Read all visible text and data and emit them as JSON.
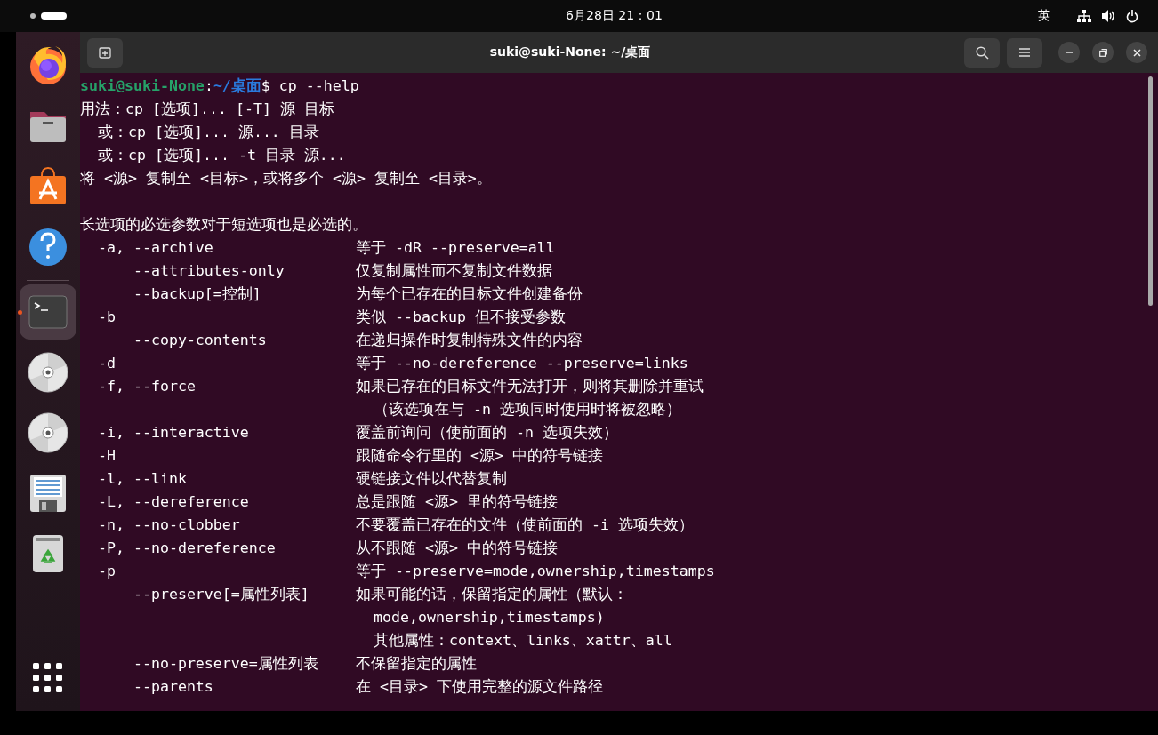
{
  "top_bar": {
    "clock": "6月28日  21：01",
    "input_method": "英"
  },
  "dock": {
    "items": [
      {
        "kind": "firefox",
        "selected": false,
        "running": false
      },
      {
        "kind": "files",
        "selected": false,
        "running": false
      },
      {
        "kind": "store",
        "selected": false,
        "running": false
      },
      {
        "kind": "help",
        "selected": false,
        "running": false
      },
      {
        "kind": "terminal",
        "selected": true,
        "running": true
      },
      {
        "kind": "disc",
        "selected": false,
        "running": false
      },
      {
        "kind": "disc",
        "selected": false,
        "running": false
      },
      {
        "kind": "document",
        "selected": false,
        "running": false
      },
      {
        "kind": "trash",
        "selected": false,
        "running": false
      },
      {
        "kind": "apps",
        "selected": false,
        "running": false
      }
    ]
  },
  "window": {
    "title": "suki@suki-None: ~/桌面"
  },
  "terminal": {
    "lines": [
      {
        "kind": "prompt",
        "user": "suki@suki-None",
        "separator": ":",
        "path": "~/桌面",
        "sign": "$",
        "command": " cp --help"
      },
      {
        "kind": "text",
        "text": "用法：cp [选项]... [-T] 源 目标"
      },
      {
        "kind": "text",
        "text": "  或：cp [选项]... 源... 目录"
      },
      {
        "kind": "text",
        "text": "  或：cp [选项]... -t 目录 源..."
      },
      {
        "kind": "text",
        "text": "将 <源> 复制至 <目标>，或将多个 <源> 复制至 <目录>。"
      },
      {
        "kind": "blank"
      },
      {
        "kind": "text",
        "text": "长选项的必选参数对于短选项也是必选的。"
      },
      {
        "kind": "option",
        "option": "  -a, --archive",
        "description": "等于 -dR --preserve=all"
      },
      {
        "kind": "option",
        "option": "      --attributes-only",
        "description": "仅复制属性而不复制文件数据"
      },
      {
        "kind": "option",
        "option": "      --backup[=控制]",
        "description": "为每个已存在的目标文件创建备份"
      },
      {
        "kind": "option",
        "option": "  -b",
        "description": "类似 --backup 但不接受参数"
      },
      {
        "kind": "option",
        "option": "      --copy-contents",
        "description": "在递归操作时复制特殊文件的内容"
      },
      {
        "kind": "option",
        "option": "  -d",
        "description": "等于 --no-dereference --preserve=links"
      },
      {
        "kind": "option",
        "option": "  -f, --force",
        "description": "如果已存在的目标文件无法打开，则将其删除并重试"
      },
      {
        "kind": "continuation",
        "description": "  （该选项在与 -n 选项同时使用时将被忽略）"
      },
      {
        "kind": "option",
        "option": "  -i, --interactive",
        "description": "覆盖前询问（使前面的 -n 选项失效）"
      },
      {
        "kind": "option",
        "option": "  -H",
        "description": "跟随命令行里的 <源> 中的符号链接"
      },
      {
        "kind": "option",
        "option": "  -l, --link",
        "description": "硬链接文件以代替复制"
      },
      {
        "kind": "option",
        "option": "  -L, --dereference",
        "description": "总是跟随 <源> 里的符号链接"
      },
      {
        "kind": "option",
        "option": "  -n, --no-clobber",
        "description": "不要覆盖已存在的文件（使前面的 -i 选项失效）"
      },
      {
        "kind": "option",
        "option": "  -P, --no-dereference",
        "description": "从不跟随 <源> 中的符号链接"
      },
      {
        "kind": "option",
        "option": "  -p",
        "description": "等于 --preserve=mode,ownership,timestamps"
      },
      {
        "kind": "option",
        "option": "      --preserve[=属性列表]",
        "description": "如果可能的话，保留指定的属性（默认："
      },
      {
        "kind": "continuation",
        "description": "  mode,ownership,timestamps)"
      },
      {
        "kind": "continuation",
        "description": "  其他属性：context、links、xattr、all"
      },
      {
        "kind": "option",
        "option": "      --no-preserve=属性列表",
        "description": "不保留指定的属性"
      },
      {
        "kind": "option",
        "option": "      --parents",
        "description": "在 <目录> 下使用完整的源文件路径"
      }
    ]
  }
}
